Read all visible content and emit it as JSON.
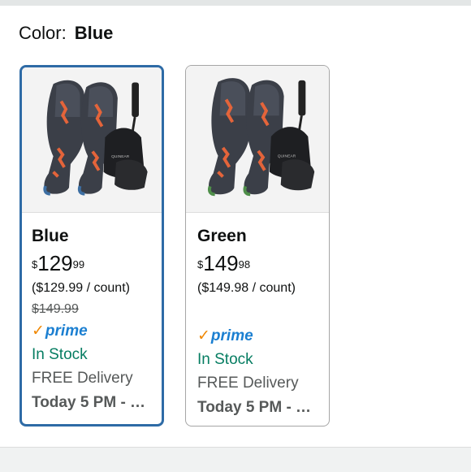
{
  "color_selector": {
    "label": "Color:",
    "selected": "Blue"
  },
  "variants": [
    {
      "name": "Blue",
      "price_symbol": "$",
      "price_whole": "129",
      "price_fraction": "99",
      "unit_price": "($129.99 / count)",
      "list_price": "$149.99",
      "prime_check": "✓",
      "prime_label": "prime",
      "stock": "In Stock",
      "delivery": "FREE Delivery",
      "delivery_date": "Today 5 PM - …",
      "image_brand": "QUINEAR",
      "accent_color": "#3d6fa3",
      "selected": true
    },
    {
      "name": "Green",
      "price_symbol": "$",
      "price_whole": "149",
      "price_fraction": "98",
      "unit_price": "($149.98 / count)",
      "prime_check": "✓",
      "prime_label": "prime",
      "stock": "In Stock",
      "delivery": "FREE Delivery",
      "delivery_date": "Today 5 PM - …",
      "image_brand": "QUINEAR",
      "accent_color": "#4f8f4a",
      "selected": false
    }
  ],
  "colors": {
    "selected_border": "#2e6ba6",
    "in_stock": "#067d62",
    "prime_blue": "#1b7fd1",
    "prime_check": "#f08804"
  }
}
